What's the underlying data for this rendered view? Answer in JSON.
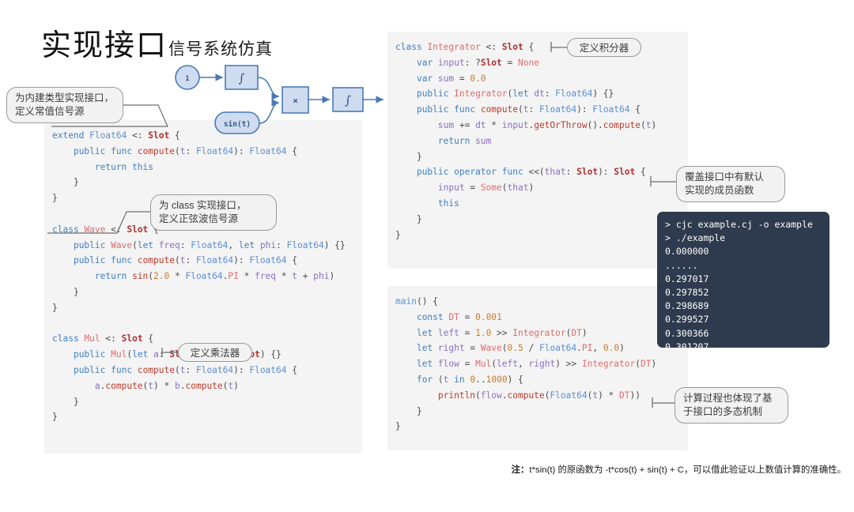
{
  "title": {
    "main": "实现接口",
    "sub": "信号系统仿真"
  },
  "diagram": {
    "nodes": {
      "const_one": "1",
      "integrator_1": "∫",
      "multiplier": "×",
      "sine": "sin(t)",
      "integrator_2": "∫"
    }
  },
  "callouts": {
    "builtin_interface": "为内建类型实现接口，\n定义常值信号源",
    "class_interface": "为 class 实现接口，\n定义正弦波信号源",
    "define_multiplier": "定义乘法器",
    "define_integrator": "定义积分器",
    "override_default": "覆盖接口中有默认\n实现的成员函数",
    "polymorphism": "计算过程也体现了基\n于接口的多态机制"
  },
  "code_left": [
    "extend Float64 <: Slot {",
    "    public func compute(t: Float64): Float64 {",
    "        return this",
    "    }",
    "}",
    "",
    "class Wave <: Slot {",
    "    public Wave(let freq: Float64, let phi: Float64) {}",
    "    public func compute(t: Float64): Float64 {",
    "        return sin(2.0 * Float64.PI * freq * t + phi)",
    "    }",
    "}",
    "",
    "class Mul <: Slot {",
    "    public Mul(let a: Slot, let b: Slot) {}",
    "    public func compute(t: Float64): Float64 {",
    "        a.compute(t) * b.compute(t)",
    "    }",
    "}"
  ],
  "code_right_top": [
    "class Integrator <: Slot {",
    "    var input: ?Slot = None",
    "    var sum = 0.0",
    "    public Integrator(let dt: Float64) {}",
    "    public func compute(t: Float64): Float64 {",
    "        sum += dt * input.getOrThrow().compute(t)",
    "        return sum",
    "    }",
    "    public operator func <<(that: Slot): Slot {",
    "        input = Some(that)",
    "        this",
    "    }",
    "}"
  ],
  "code_right_bottom": [
    "main() {",
    "    const DT = 0.001",
    "    let left = 1.0 >> Integrator(DT)",
    "    let right = Wave(0.5 / Float64.PI, 0.0)",
    "    let flow = Mul(left, right) >> Integrator(DT)",
    "    for (t in 0..1000) {",
    "        println(flow.compute(Float64(t) * DT))",
    "    }",
    "}"
  ],
  "terminal": {
    "lines": [
      "> cjc example.cj -o example",
      "> ./example",
      "0.000000",
      "......",
      "0.297017",
      "0.297852",
      "0.298689",
      "0.299527",
      "0.300366",
      "0.301207"
    ]
  },
  "footer": {
    "label": "注：",
    "text": "t*sin(t) 的原函数为 -t*cos(t) + sin(t) + C，可以借此验证以上数值计算的准确性。"
  },
  "colors": {
    "panel_bg": "#f4f4f4",
    "terminal_bg": "#2e3a4d",
    "diagram_accent": "#4a7ab5",
    "diagram_fill": "#cfdcf0",
    "callout_border": "#9a9a9a"
  }
}
